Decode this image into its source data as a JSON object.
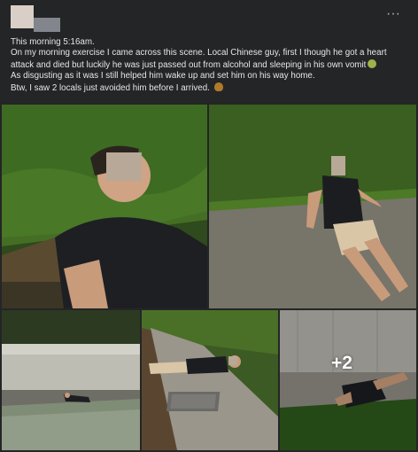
{
  "post": {
    "lines": [
      "This morning 5:16am.",
      "On my morning exercise I came across this scene. Local Chinese guy, first I though he got a heart attack and died but luckily he was just passed out from alcohol and sleeping in his own vomit",
      "As disgusting as it was I still helped him wake up and set him on his way home.",
      "Btw, I saw 2 locals just avoided him before I arrived."
    ],
    "more_glyph": "···",
    "extra_photos_label": "+2"
  },
  "icons": [
    "more-options-icon",
    "nauseated-face-emoji",
    "poop-emoji"
  ]
}
